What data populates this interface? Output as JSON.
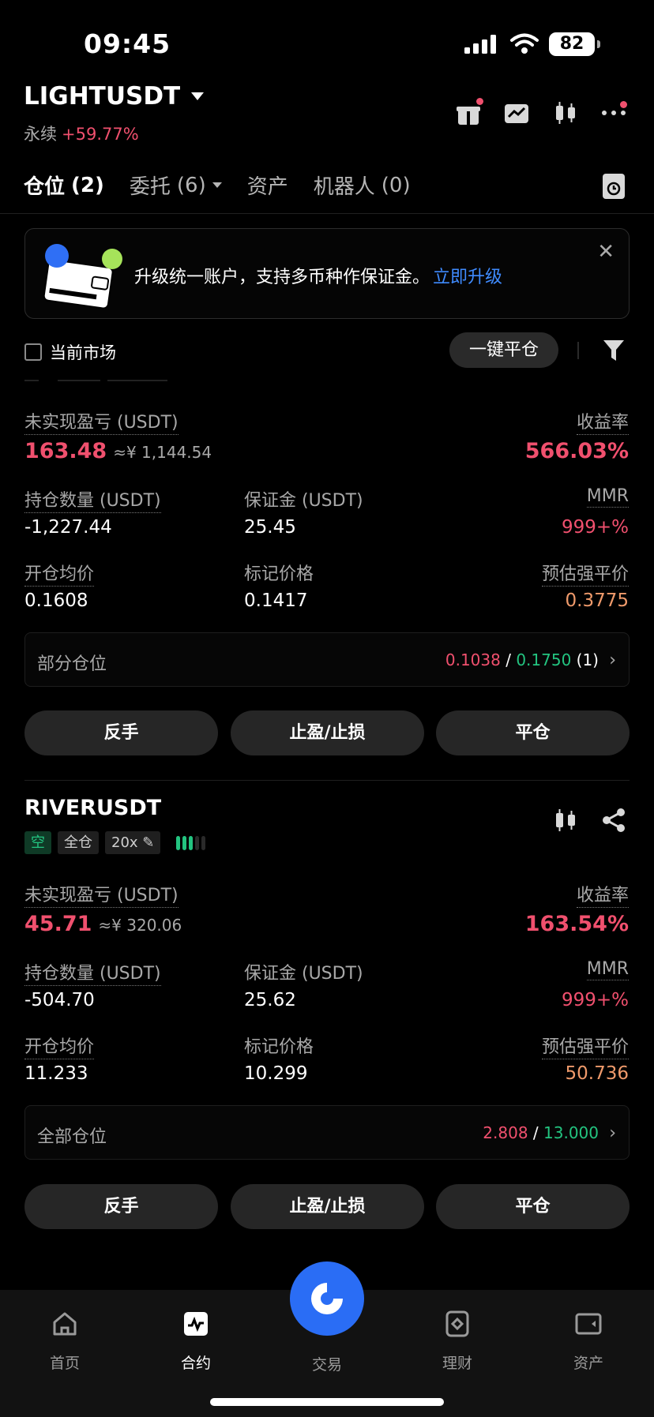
{
  "status_bar": {
    "time": "09:45",
    "battery": "82"
  },
  "header": {
    "pair": "LIGHTUSDT",
    "type": "永续",
    "change": "+59.77%"
  },
  "tabs": [
    {
      "label": "仓位",
      "count": "(2)"
    },
    {
      "label": "委托",
      "count": "(6)"
    },
    {
      "label": "资产",
      "count": ""
    },
    {
      "label": "机器人",
      "count": "(0)"
    }
  ],
  "banner": {
    "text": "升级统一账户，支持多币种作保证金。",
    "link": "立即升级",
    "close": "✕"
  },
  "filter_bar": {
    "current_market": "当前市场",
    "close_all": "一键平仓"
  },
  "labels": {
    "unrealized_pnl": "未实现盈亏 (USDT)",
    "roe": "收益率",
    "position_size": "持仓数量 (USDT)",
    "margin": "保证金 (USDT)",
    "mmr": "MMR",
    "entry_price": "开仓均价",
    "mark_price": "标记价格",
    "liq_price": "预估强平价",
    "reverse": "反手",
    "tp_sl": "止盈/止损",
    "close": "平仓",
    "slash": "/"
  },
  "positions": [
    {
      "pnl": "163.48",
      "pnl_cny": "≈¥ 1,144.54",
      "roe": "566.03%",
      "size": "-1,227.44",
      "margin": "25.45",
      "mmr": "999+%",
      "entry": "0.1608",
      "mark": "0.1417",
      "liq": "0.3775",
      "tpsl_label": "部分仓位",
      "tp": "0.1038",
      "sl": "0.1750",
      "tpsl_count": "(1)"
    },
    {
      "symbol": "RIVERUSDT",
      "side": "空",
      "margin_mode": "全仓",
      "leverage": "20x",
      "pnl": "45.71",
      "pnl_cny": "≈¥ 320.06",
      "roe": "163.54%",
      "size": "-504.70",
      "margin": "25.62",
      "mmr": "999+%",
      "entry": "11.233",
      "mark": "10.299",
      "liq": "50.736",
      "tpsl_label": "全部仓位",
      "tp": "2.808",
      "sl": "13.000",
      "tpsl_count": ""
    }
  ],
  "nav": [
    {
      "label": "首页"
    },
    {
      "label": "合约"
    },
    {
      "label": "交易"
    },
    {
      "label": "理财"
    },
    {
      "label": "资产"
    }
  ],
  "colors": {
    "up": "#f0506e",
    "down": "#23c480",
    "accent": "#2a6df5",
    "liq": "#ef9a6b"
  }
}
